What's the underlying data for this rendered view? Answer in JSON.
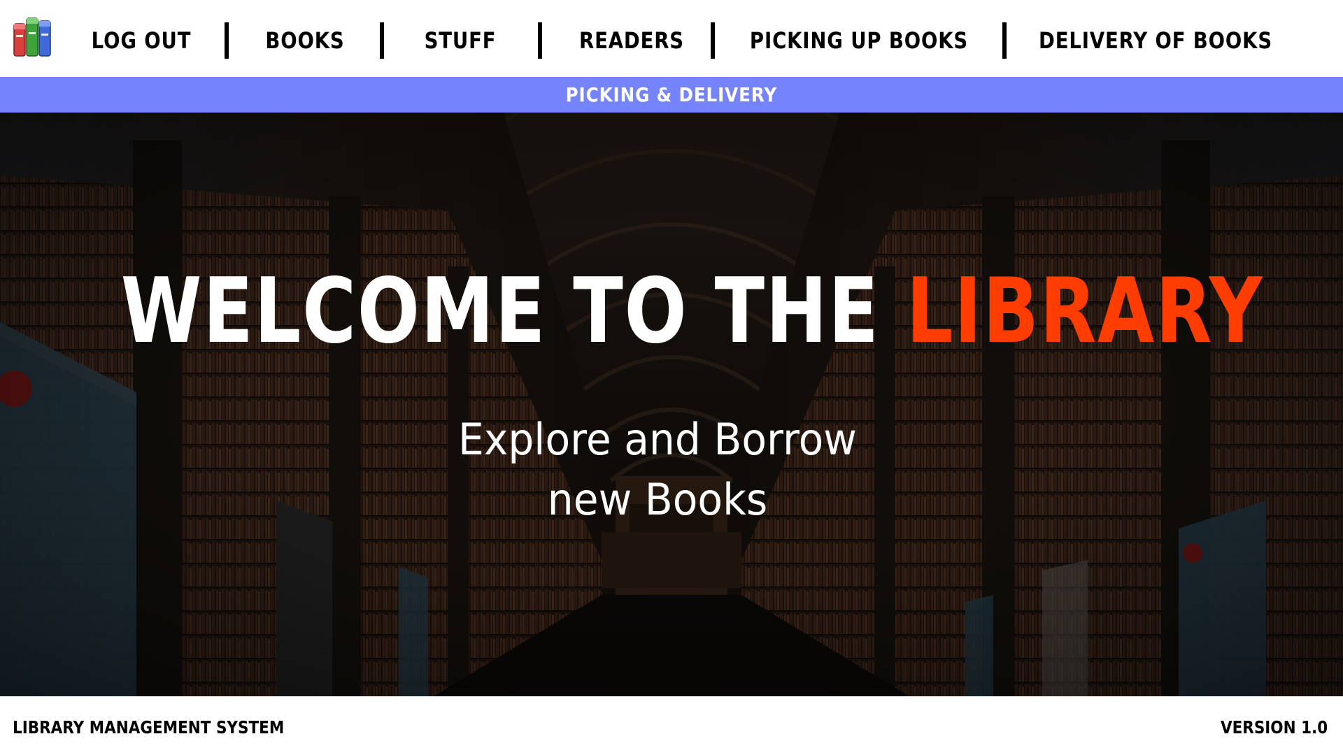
{
  "header": {
    "logo_icon": "books-icon",
    "nav": [
      {
        "label": "LOG OUT"
      },
      {
        "label": "BOOKS"
      },
      {
        "label": "STUFF"
      },
      {
        "label": "READERS"
      },
      {
        "label": "PICKING UP BOOKS"
      },
      {
        "label": "DELIVERY OF BOOKS"
      }
    ]
  },
  "subbar": {
    "label": "PICKING & DELIVERY",
    "color": "#7584fb"
  },
  "hero": {
    "title_main": "WELCOME TO THE ",
    "title_accent": "LIBRARY",
    "accent_color": "#ff3d00",
    "subtitle_line1": "Explore and Borrow",
    "subtitle_line2": "new Books",
    "background": "dark library hall with bookshelves"
  },
  "footer": {
    "left": "LIBRARY MANAGEMENT SYSTEM",
    "right": "VERSION 1.0"
  }
}
